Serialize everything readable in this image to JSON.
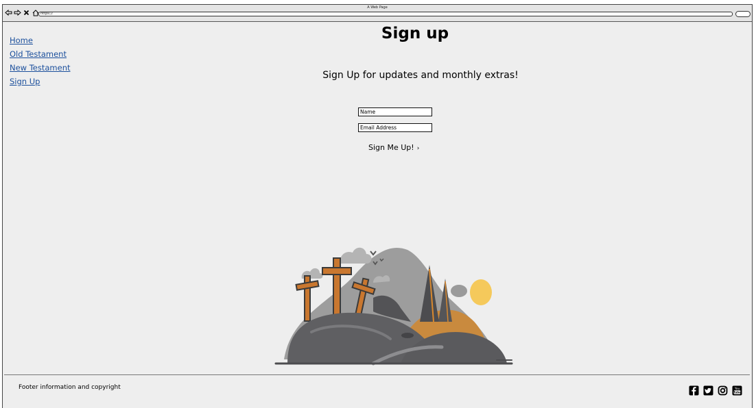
{
  "browser": {
    "window_title": "A Web Page",
    "url": "https://",
    "nav_icons": [
      "back-icon",
      "forward-icon",
      "stop-icon",
      "home-icon"
    ]
  },
  "sidebar": {
    "links": [
      {
        "label": "Home"
      },
      {
        "label": "Old Testament"
      },
      {
        "label": "New Testament"
      },
      {
        "label": "Sign Up"
      }
    ]
  },
  "main": {
    "title": "Sign up",
    "subtitle": "Sign Up for updates and monthly extras!",
    "form": {
      "name_placeholder": "Name",
      "email_placeholder": "Email Address",
      "submit_label": "Sign Me Up!",
      "submit_icon": "chevron-right-icon"
    },
    "illustration": "three-crosses-hill-illustration"
  },
  "footer": {
    "text": "Footer information and copyright",
    "social_icons": [
      "facebook-icon",
      "twitter-icon",
      "instagram-icon",
      "youtube-icon"
    ]
  },
  "colors": {
    "link": "#1b4f9c",
    "page_bg": "#eeeeee",
    "sun": "#f5c95b",
    "cross": "#c9772f",
    "hill_dark": "#5f5f62",
    "hill_light": "#9c9c9c"
  }
}
